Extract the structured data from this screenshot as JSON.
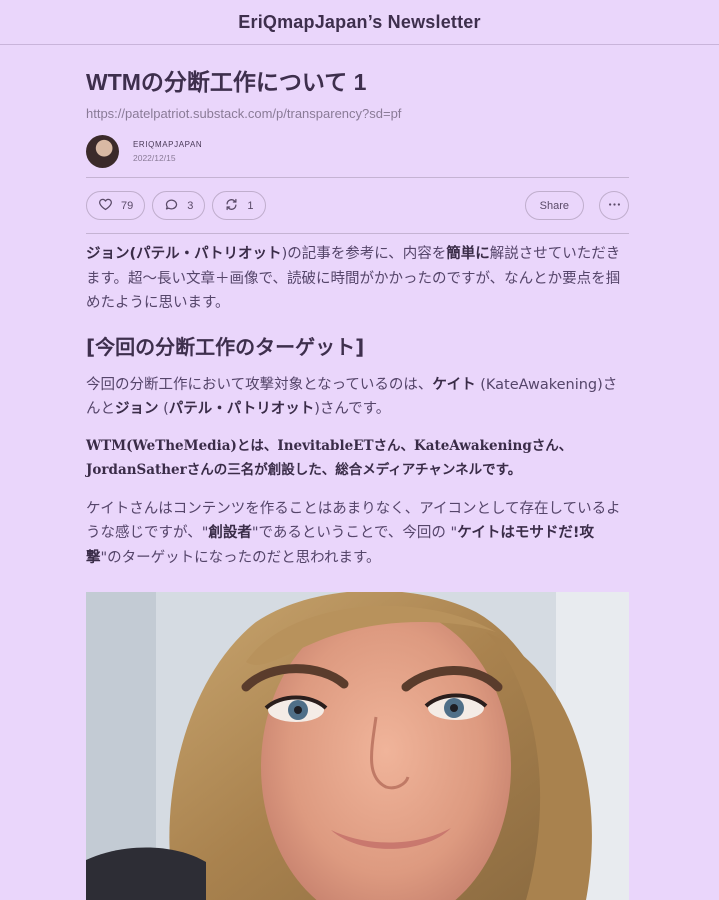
{
  "header": {
    "newsletter_title": "EriQmapJapan’s Newsletter"
  },
  "post": {
    "title": "WTMの分断工作について 1",
    "url": "https://patelpatriot.substack.com/p/transparency?sd=pf",
    "author": "ERIQMAPJAPAN",
    "date": "2022/12/15"
  },
  "actions": {
    "likes": "79",
    "comments": "3",
    "restacks": "1",
    "share_label": "Share",
    "icons": [
      "heart-icon",
      "comment-icon",
      "restack-icon",
      "more-icon"
    ]
  },
  "body": {
    "p1": {
      "a": "ジョン",
      "b": "(パテル・パトリオット",
      "c": ")の記事を参考に、内容を",
      "d": "簡単に",
      "e": "解説させていただきます。超〜長い文章＋画像で、読破に時間がかかったのですが、なんとか要点を掴めたように思います。"
    },
    "section_heading": "[今回の分断工作のターゲット]",
    "p2": {
      "a": "今回の分断工作において攻撃対象となっているのは、",
      "b": "ケイト",
      "c": " (KateAwakening)さんと",
      "d": "ジョン",
      "e": " (",
      "f": "パテル・パトリオット",
      "g": ")さんです。"
    },
    "p3": "WTM(WeTheMedia)とは、InevitableETさん、KateAwakeningさん、JordanSatherさんの三名が創設した、総合メディアチャンネルです。",
    "p4": {
      "a": "ケイトさんはコンテンツを作ることはあまりなく、アイコンとして存在しているような感じですが、\"",
      "b": "創設者",
      "c": "\"であるということで、今回の \"",
      "d": "ケイトはモサドだ!攻撃",
      "e": "\"のターゲットになったのだと思われます。"
    }
  },
  "colors": {
    "background": "#ead6fb",
    "heading": "#3e2f4d",
    "body_text": "#55456a",
    "muted": "#8a7b97",
    "border": "#c0aecd"
  }
}
